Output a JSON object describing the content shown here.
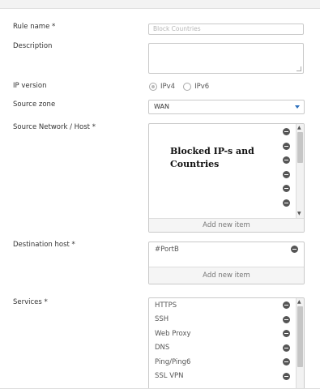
{
  "form": {
    "rule_name": {
      "label": "Rule name *",
      "placeholder": "Block Countries"
    },
    "description": {
      "label": "Description",
      "value": ""
    },
    "ip_version": {
      "label": "IP version",
      "options": [
        "IPv4",
        "IPv6"
      ],
      "selected": "IPv4"
    },
    "source_zone": {
      "label": "Source zone",
      "value": "WAN"
    },
    "source_network": {
      "label": "Source Network / Host *",
      "items": [
        "",
        "",
        "",
        "",
        "",
        ""
      ],
      "add_label": "Add new item",
      "annotation_line1": "Blocked IP-s and",
      "annotation_line2": "Countries"
    },
    "destination_host": {
      "label": "Destination host *",
      "items": [
        "#PortB"
      ],
      "add_label": "Add new item"
    },
    "services": {
      "label": "Services *",
      "items": [
        "HTTPS",
        "SSH",
        "Web Proxy",
        "DNS",
        "Ping/Ping6",
        "SSL VPN"
      ]
    }
  },
  "icons": {
    "remove": "minus-circle-icon",
    "dropdown": "chevron-down-icon",
    "scroll_up": "scroll-up-arrow-icon",
    "scroll_down": "scroll-down-arrow-icon"
  },
  "colors": {
    "accent": "#2a6ebb",
    "remove_icon": "#555555"
  }
}
